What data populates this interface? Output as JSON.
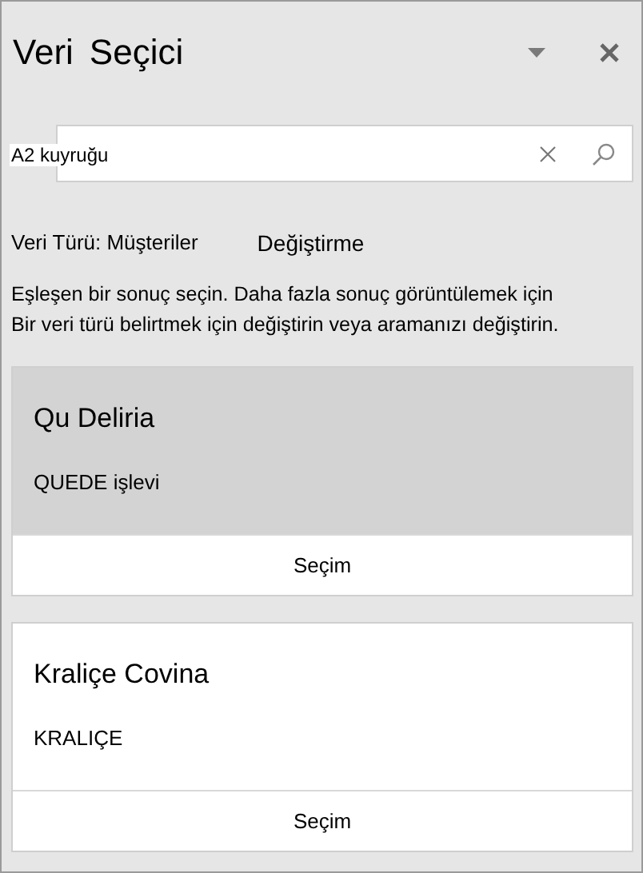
{
  "pane": {
    "title_words": [
      "Veri",
      "Seçici"
    ]
  },
  "search": {
    "value": "A2 kuyruğu"
  },
  "data_type": {
    "label": "Veri Türü: Müşteriler",
    "change_link": "Değiştirme"
  },
  "instructions": [
    "Eşleşen bir sonuç seçin. Daha fazla sonuç görüntülemek için",
    "Bir veri türü belirtmek için değiştirin veya aramanızı değiştirin."
  ],
  "results": [
    {
      "title": "Qu Deliria",
      "subtitle": "QUEDE işlevi",
      "button": "Seçim",
      "selected": true
    },
    {
      "title": "Kraliçe Covina",
      "subtitle": "KRALIÇE",
      "button": "Seçim",
      "selected": false
    }
  ]
}
